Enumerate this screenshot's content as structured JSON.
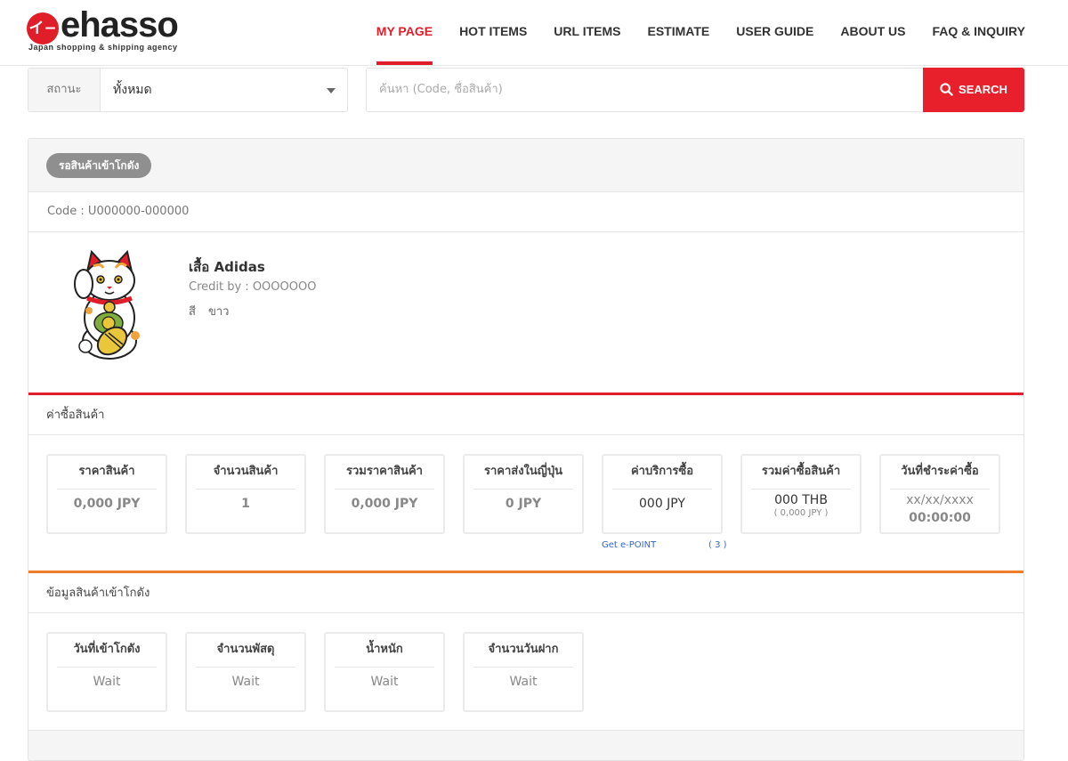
{
  "brand": {
    "logo_mark": "イ−",
    "name": "ehasso",
    "tagline": "Japan shopping & shipping agency",
    "accent": "#e01e29"
  },
  "nav": [
    {
      "label": "MY PAGE",
      "active": true
    },
    {
      "label": "HOT ITEMS"
    },
    {
      "label": "URL ITEMS"
    },
    {
      "label": "ESTIMATE"
    },
    {
      "label": "USER GUIDE"
    },
    {
      "label": "ABOUT US"
    },
    {
      "label": "FAQ & INQUIRY"
    }
  ],
  "filter": {
    "status_label": "สถานะ",
    "status_value": "ทั้งหมด",
    "search_placeholder": "ค้นหา (Code, ชื่อสินค้า)",
    "search_button": "SEARCH",
    "search_icon": "search-icon"
  },
  "order": {
    "status_badge": "รอสินค้าเข้าโกดัง",
    "code": "Code : U000000-000000",
    "product": {
      "name": "เสื้อ Adidas",
      "credit": "Credit by : OOOOOOO",
      "color_label": "สี",
      "color_value": "ขาว",
      "image": "maneki-neko-cat-image"
    },
    "purchase": {
      "title": "ค่าซื้อสินค้า",
      "boxes": [
        {
          "label": "ราคาสินค้า",
          "value": "0,000 JPY"
        },
        {
          "label": "จำนวนสินค้า",
          "value": "1"
        },
        {
          "label": "รวมราคาสินค้า",
          "value": "0,000 JPY"
        },
        {
          "label": "ราคาส่งในญี่ปุ่น",
          "value": "0 JPY"
        },
        {
          "label": "ค่าบริการซื้อ",
          "value": "000 JPY"
        },
        {
          "label": "รวมค่าซื้อสินค้า",
          "value": "000 THB",
          "sub": "( 0,000 JPY )"
        },
        {
          "label": "วันที่ชำระค่าซื้อ",
          "value": "xx/xx/xxxx",
          "value2": "00:00:00"
        }
      ],
      "epoint_label": "Get e-POINT",
      "epoint_count": "( 3 )"
    },
    "warehouse": {
      "title": "ข้อมูลสินค้าเข้าโกดัง",
      "boxes": [
        {
          "label": "วันที่เข้าโกดัง",
          "value": "Wait"
        },
        {
          "label": "จำนวนพัสดุ",
          "value": "Wait"
        },
        {
          "label": "น้ำหนัก",
          "value": "Wait"
        },
        {
          "label": "จำนวนวันฝาก",
          "value": "Wait"
        }
      ]
    }
  }
}
